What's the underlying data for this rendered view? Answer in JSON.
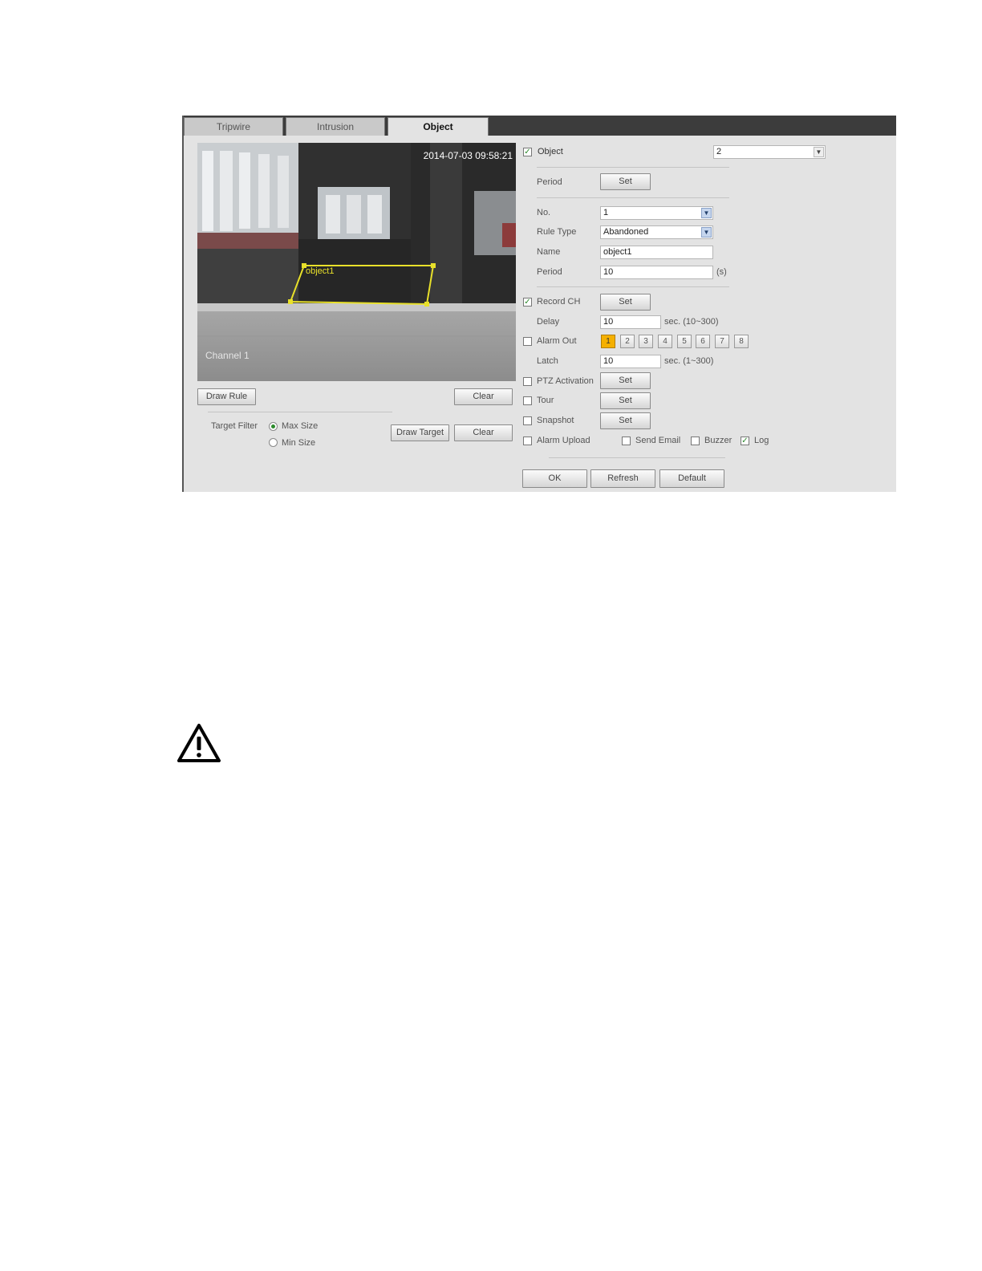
{
  "tabs": [
    {
      "label": "Tripwire",
      "active": false
    },
    {
      "label": "Intrusion",
      "active": false
    },
    {
      "label": "Object",
      "active": true
    }
  ],
  "video": {
    "timestamp": "2014-07-03 09:58:21",
    "channel_label": "Channel 1",
    "region_label": "object1",
    "region_color": "#e8e02a"
  },
  "left_controls": {
    "draw_rule": "Draw Rule",
    "clear_rule": "Clear",
    "target_filter_label": "Target Filter",
    "max_size": "Max Size",
    "min_size": "Min Size",
    "selected_size": "Max Size",
    "draw_target": "Draw Target",
    "clear_target": "Clear"
  },
  "form": {
    "object_label": "Object",
    "object_checked": true,
    "object_select": "2",
    "period_label": "Period",
    "period_set": "Set",
    "no_label": "No.",
    "no_value": "1",
    "rule_type_label": "Rule Type",
    "rule_type_value": "Abandoned",
    "name_label": "Name",
    "name_value": "object1",
    "period2_label": "Period",
    "period2_value": "10",
    "period2_unit": "(s)",
    "record_ch_label": "Record CH",
    "record_ch_checked": true,
    "record_ch_set": "Set",
    "delay_label": "Delay",
    "delay_value": "10",
    "delay_range": "sec. (10~300)",
    "alarm_out_label": "Alarm Out",
    "alarm_out_checked": false,
    "alarm_channels": [
      "1",
      "2",
      "3",
      "4",
      "5",
      "6",
      "7",
      "8"
    ],
    "alarm_active_channel": "1",
    "latch_label": "Latch",
    "latch_value": "10",
    "latch_range": "sec. (1~300)",
    "ptz_label": "PTZ Activation",
    "ptz_set": "Set",
    "tour_label": "Tour",
    "tour_set": "Set",
    "snapshot_label": "Snapshot",
    "snapshot_set": "Set",
    "alarm_upload_label": "Alarm Upload",
    "send_email_label": "Send Email",
    "buzzer_label": "Buzzer",
    "log_label": "Log",
    "log_checked": true
  },
  "footer": {
    "ok": "OK",
    "refresh": "Refresh",
    "default": "Default"
  },
  "warning_icon": "warning-triangle-icon"
}
